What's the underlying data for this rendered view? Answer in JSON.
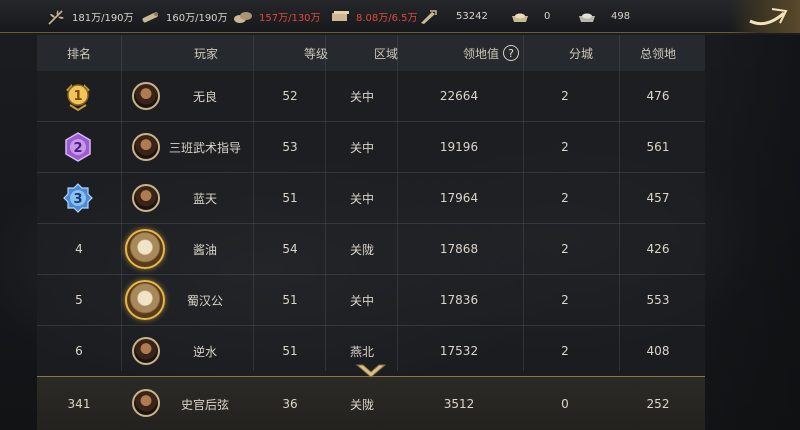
{
  "resources": [
    {
      "icon": "grain-icon",
      "value": "181万/190万",
      "warn": false
    },
    {
      "icon": "wood-icon",
      "value": "160万/190万",
      "warn": false
    },
    {
      "icon": "stone-icon",
      "value": "157万/130万",
      "warn": true
    },
    {
      "icon": "iron-icon",
      "value": "8.08万/6.5万",
      "warn": true
    },
    {
      "icon": "decree-icon",
      "value": "53242",
      "warn": false
    },
    {
      "icon": "gold-ingot-icon",
      "value": "0",
      "warn": false
    },
    {
      "icon": "silver-ingot-icon",
      "value": "498",
      "warn": false
    }
  ],
  "table": {
    "headers": {
      "rank": "排名",
      "player": "玩家",
      "level": "等级",
      "region": "区域",
      "territory": "领地值",
      "help": "?",
      "city": "分城",
      "total": "总领地"
    },
    "rows": [
      {
        "rank": "1",
        "name": "无良",
        "level": "52",
        "region": "关中",
        "territory": "22664",
        "city": "2",
        "total": "476"
      },
      {
        "rank": "2",
        "name": "三班武术指导",
        "level": "53",
        "region": "关中",
        "territory": "19196",
        "city": "2",
        "total": "561"
      },
      {
        "rank": "3",
        "name": "蓝天",
        "level": "51",
        "region": "关中",
        "territory": "17964",
        "city": "2",
        "total": "457"
      },
      {
        "rank": "4",
        "name": "酱油",
        "level": "54",
        "region": "关陇",
        "territory": "17868",
        "city": "2",
        "total": "426"
      },
      {
        "rank": "5",
        "name": "蜀汉公",
        "level": "51",
        "region": "关中",
        "territory": "17836",
        "city": "2",
        "total": "553"
      },
      {
        "rank": "6",
        "name": "逆水",
        "level": "51",
        "region": "燕北",
        "territory": "17532",
        "city": "2",
        "total": "408"
      }
    ],
    "self": {
      "rank": "341",
      "name": "史官后弦",
      "level": "36",
      "region": "关陇",
      "territory": "3512",
      "city": "0",
      "total": "252"
    }
  },
  "colors": {
    "accent_gold": "#c9a75a",
    "warn_red": "#e04a3a",
    "medal_gold": "#e8b840",
    "medal_purple": "#9a5cd0",
    "medal_blue": "#4a8ad8"
  }
}
